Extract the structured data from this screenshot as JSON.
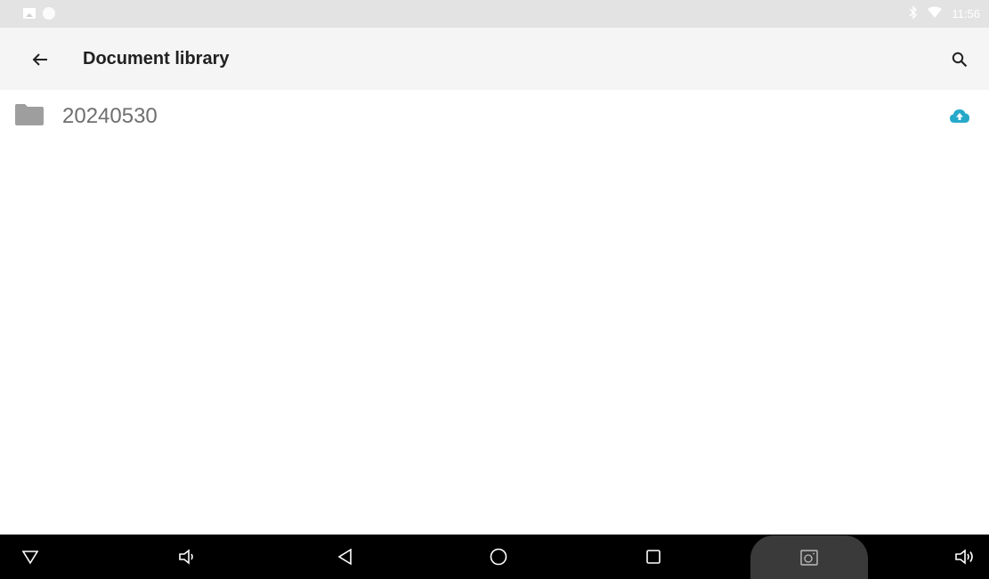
{
  "status_bar": {
    "time": "11:56",
    "notification_icons": [
      "image-icon",
      "circle-icon"
    ],
    "system_icons": [
      "bluetooth-icon",
      "wifi-icon"
    ]
  },
  "toolbar": {
    "title": "Document library",
    "back_icon": "arrow-left-icon",
    "search_icon": "search-icon"
  },
  "files": [
    {
      "name": "20240530",
      "type_icon": "folder-icon",
      "action_icon": "cloud-upload-icon",
      "action_color": "#26a9c9"
    }
  ],
  "navigation_bar": {
    "buttons": [
      "hide-bar-icon",
      "volume-down-icon",
      "back-triangle-icon",
      "home-circle-icon",
      "recents-square-icon",
      "screenshot-icon",
      "volume-up-icon"
    ]
  },
  "colors": {
    "status_bar_bg": "#e3e3e3",
    "toolbar_bg": "#f5f5f5",
    "nav_bar_bg": "#000000",
    "folder_icon": "#9e9e9e",
    "accent": "#26a9c9"
  }
}
